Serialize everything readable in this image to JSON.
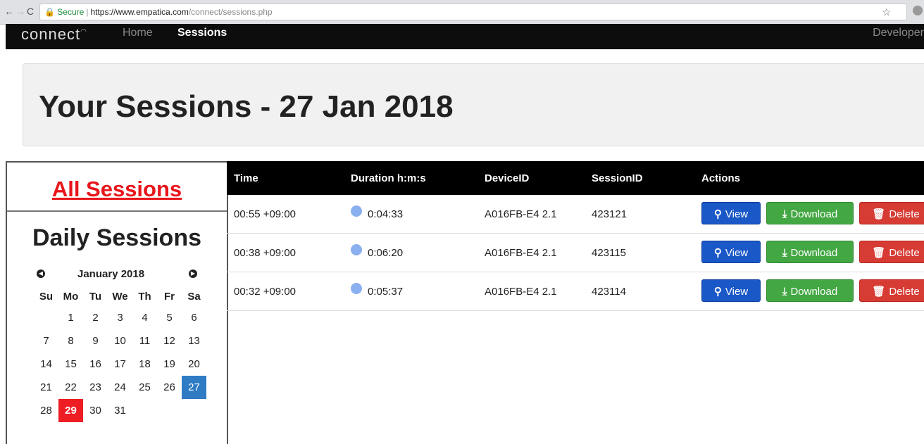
{
  "browser": {
    "secure_label": "Secure",
    "url_host": "https://www.empatica.com",
    "url_path": "/connect/sessions.php"
  },
  "navbar": {
    "brand": "connect",
    "home": "Home",
    "sessions": "Sessions",
    "developer": "Developer"
  },
  "page": {
    "title": "Your Sessions - 27 Jan 2018"
  },
  "sidebar": {
    "all_sessions": "All Sessions",
    "daily_sessions": "Daily Sessions"
  },
  "calendar": {
    "month": "January 2018",
    "weekdays": [
      "Su",
      "Mo",
      "Tu",
      "We",
      "Th",
      "Fr",
      "Sa"
    ],
    "weeks": [
      [
        "",
        "1",
        "2",
        "3",
        "4",
        "5",
        "6"
      ],
      [
        "7",
        "8",
        "9",
        "10",
        "11",
        "12",
        "13"
      ],
      [
        "14",
        "15",
        "16",
        "17",
        "18",
        "19",
        "20"
      ],
      [
        "21",
        "22",
        "23",
        "24",
        "25",
        "26",
        "27"
      ],
      [
        "28",
        "29",
        "30",
        "31",
        "",
        "",
        ""
      ]
    ],
    "selected_day": "27",
    "today": "29",
    "colors": {
      "selected": "#2f7bc4",
      "today": "#ee1d24"
    }
  },
  "table": {
    "headers": [
      "Time",
      "Duration h:m:s",
      "DeviceID",
      "SessionID",
      "Actions"
    ],
    "rows": [
      {
        "time": "00:55 +09:00",
        "duration": "0:04:33",
        "device": "A016FB-E4 2.1",
        "session": "423121"
      },
      {
        "time": "00:38 +09:00",
        "duration": "0:06:20",
        "device": "A016FB-E4 2.1",
        "session": "423115"
      },
      {
        "time": "00:32 +09:00",
        "duration": "0:05:37",
        "device": "A016FB-E4 2.1",
        "session": "423114"
      }
    ],
    "actions": {
      "view": "View",
      "download": "Download",
      "delete": "Delete"
    },
    "colors": {
      "view": "#1a57c7",
      "download": "#43a743",
      "delete": "#d63b34"
    }
  }
}
